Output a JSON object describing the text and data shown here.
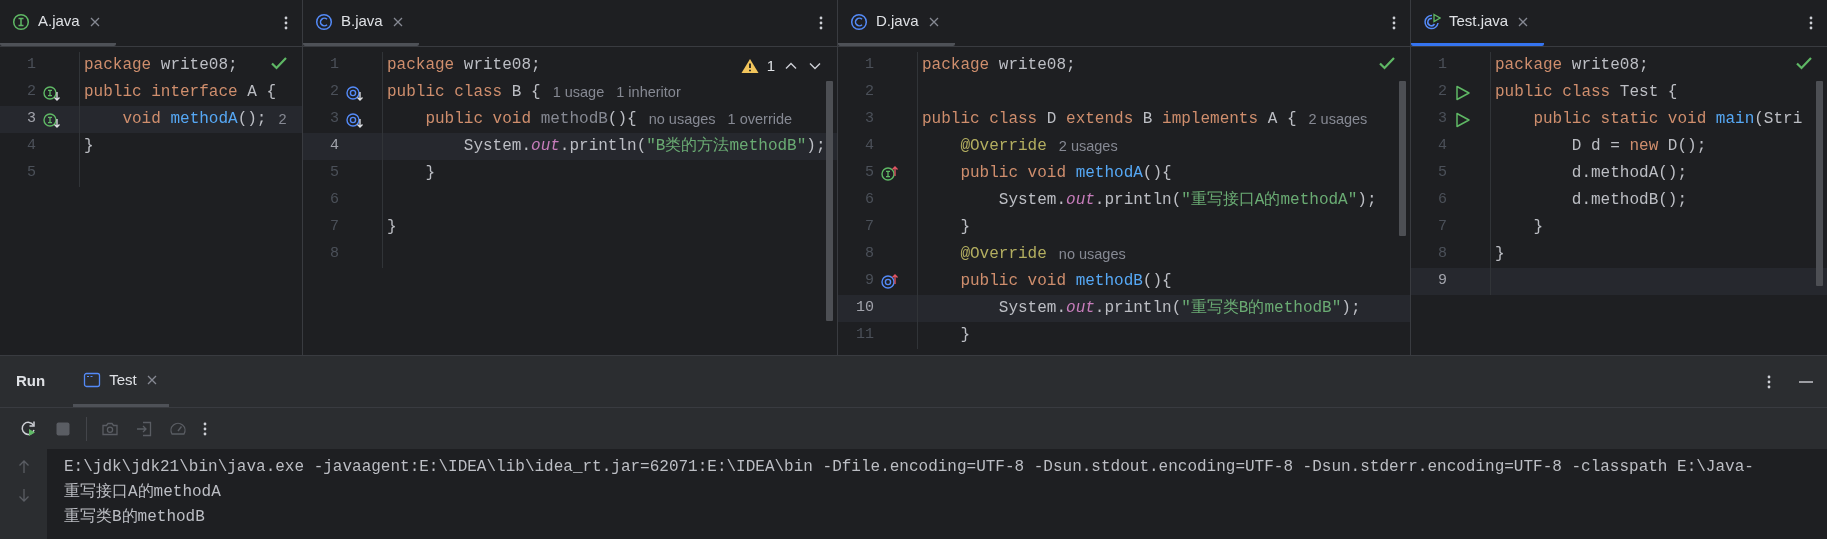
{
  "editors": [
    {
      "tab": {
        "label": "A.java",
        "kind": "interface",
        "selected": false
      },
      "status": {
        "kind": "ok"
      },
      "lines": [
        {
          "number": "1",
          "current": false,
          "tokens": [
            {
              "kind": "kw",
              "text": "package "
            },
            {
              "kind": "plain",
              "text": "write08;"
            }
          ]
        },
        {
          "number": "2",
          "current": false,
          "gutter": {
            "kind": "interface-impl"
          },
          "tokens": [
            {
              "kind": "kw",
              "text": "public interface "
            },
            {
              "kind": "plain",
              "text": "A {"
            }
          ]
        },
        {
          "number": "3",
          "current": true,
          "gutter": {
            "kind": "interface-impl"
          },
          "tokens": [
            {
              "kind": "kw",
              "text": "    void "
            },
            {
              "kind": "fn",
              "text": "methodA"
            },
            {
              "kind": "plain",
              "text": "();"
            }
          ],
          "hints": [
            "2"
          ]
        },
        {
          "number": "4",
          "current": false,
          "tokens": [
            {
              "kind": "plain",
              "text": "}"
            }
          ]
        },
        {
          "number": "5",
          "current": false
        }
      ]
    },
    {
      "tab": {
        "label": "B.java",
        "kind": "class",
        "selected": false
      },
      "status": {
        "kind": "warning",
        "count": "1"
      },
      "lines": [
        {
          "number": "1",
          "current": false,
          "tokens": [
            {
              "kind": "kw",
              "text": "package "
            },
            {
              "kind": "plain",
              "text": "write08;"
            }
          ]
        },
        {
          "number": "2",
          "current": false,
          "gutter": {
            "kind": "class-impl"
          },
          "tokens": [
            {
              "kind": "kw",
              "text": "public class "
            },
            {
              "kind": "plain",
              "text": "B {"
            }
          ],
          "hints": [
            "1 usage",
            "1 inheritor"
          ]
        },
        {
          "number": "3",
          "current": false,
          "gutter": {
            "kind": "class-impl"
          },
          "tokens": [
            {
              "kind": "kw",
              "text": "    public void "
            },
            {
              "kind": "unused",
              "text": "methodB"
            },
            {
              "kind": "plain",
              "text": "(){"
            }
          ],
          "hints": [
            "no usages",
            "1 override"
          ]
        },
        {
          "number": "4",
          "current": true,
          "tokens": [
            {
              "kind": "plain",
              "text": "        System."
            },
            {
              "kind": "field",
              "text": "out"
            },
            {
              "kind": "plain",
              "text": ".println("
            },
            {
              "kind": "str",
              "text": "\"B类的方法methodB\""
            },
            {
              "kind": "plain",
              "text": ");"
            }
          ]
        },
        {
          "number": "5",
          "current": false,
          "tokens": [
            {
              "kind": "plain",
              "text": "    }"
            }
          ]
        },
        {
          "number": "6",
          "current": false
        },
        {
          "number": "7",
          "current": false,
          "tokens": [
            {
              "kind": "plain",
              "text": "}"
            }
          ]
        },
        {
          "number": "8",
          "current": false
        }
      ]
    },
    {
      "tab": {
        "label": "D.java",
        "kind": "class",
        "selected": false
      },
      "status": {
        "kind": "ok"
      },
      "lines": [
        {
          "number": "1",
          "current": false,
          "tokens": [
            {
              "kind": "kw",
              "text": "package "
            },
            {
              "kind": "plain",
              "text": "write08;"
            }
          ]
        },
        {
          "number": "2",
          "current": false
        },
        {
          "number": "3",
          "current": false,
          "tokens": [
            {
              "kind": "kw",
              "text": "public class "
            },
            {
              "kind": "plain",
              "text": "D "
            },
            {
              "kind": "kw",
              "text": "extends "
            },
            {
              "kind": "plain",
              "text": "B "
            },
            {
              "kind": "kw",
              "text": "implements "
            },
            {
              "kind": "plain",
              "text": "A {"
            }
          ],
          "hints": [
            "2 usages"
          ]
        },
        {
          "number": "4",
          "current": false,
          "tokens": [
            {
              "kind": "ann",
              "text": "    @Override"
            }
          ],
          "hints": [
            "2 usages"
          ]
        },
        {
          "number": "5",
          "current": false,
          "gutter": {
            "kind": "implements-up"
          },
          "tokens": [
            {
              "kind": "kw",
              "text": "    public void "
            },
            {
              "kind": "fn",
              "text": "methodA"
            },
            {
              "kind": "plain",
              "text": "(){"
            }
          ]
        },
        {
          "number": "6",
          "current": false,
          "tokens": [
            {
              "kind": "plain",
              "text": "        System."
            },
            {
              "kind": "field",
              "text": "out"
            },
            {
              "kind": "plain",
              "text": ".println("
            },
            {
              "kind": "str",
              "text": "\"重写接口A的methodA\""
            },
            {
              "kind": "plain",
              "text": ");"
            }
          ]
        },
        {
          "number": "7",
          "current": false,
          "tokens": [
            {
              "kind": "plain",
              "text": "    }"
            }
          ]
        },
        {
          "number": "8",
          "current": false,
          "tokens": [
            {
              "kind": "ann",
              "text": "    @Override"
            }
          ],
          "hints": [
            "no usages"
          ]
        },
        {
          "number": "9",
          "current": false,
          "gutter": {
            "kind": "override-up"
          },
          "tokens": [
            {
              "kind": "kw",
              "text": "    public void "
            },
            {
              "kind": "fn",
              "text": "methodB"
            },
            {
              "kind": "plain",
              "text": "(){"
            }
          ]
        },
        {
          "number": "10",
          "current": true,
          "tokens": [
            {
              "kind": "plain",
              "text": "        System."
            },
            {
              "kind": "field",
              "text": "out"
            },
            {
              "kind": "plain",
              "text": ".println("
            },
            {
              "kind": "str",
              "text": "\"重写类B的methodB\""
            },
            {
              "kind": "plain",
              "text": ");"
            }
          ]
        },
        {
          "number": "11",
          "current": false,
          "tokens": [
            {
              "kind": "plain",
              "text": "    }"
            }
          ]
        }
      ]
    },
    {
      "tab": {
        "label": "Test.java",
        "kind": "runnable-class",
        "selected": true
      },
      "status": {
        "kind": "ok"
      },
      "lines": [
        {
          "number": "1",
          "current": false,
          "tokens": [
            {
              "kind": "kw",
              "text": "package "
            },
            {
              "kind": "plain",
              "text": "write08;"
            }
          ]
        },
        {
          "number": "2",
          "current": false,
          "gutter": {
            "kind": "run"
          },
          "tokens": [
            {
              "kind": "kw",
              "text": "public class "
            },
            {
              "kind": "plain",
              "text": "Test {"
            }
          ]
        },
        {
          "number": "3",
          "current": false,
          "gutter": {
            "kind": "run"
          },
          "tokens": [
            {
              "kind": "kw",
              "text": "    public static void "
            },
            {
              "kind": "fn",
              "text": "main"
            },
            {
              "kind": "plain",
              "text": "(Stri"
            }
          ]
        },
        {
          "number": "4",
          "current": false,
          "tokens": [
            {
              "kind": "plain",
              "text": "        D d = "
            },
            {
              "kind": "kw",
              "text": "new "
            },
            {
              "kind": "plain",
              "text": "D();"
            }
          ]
        },
        {
          "number": "5",
          "current": false,
          "tokens": [
            {
              "kind": "plain",
              "text": "        d.methodA();"
            }
          ]
        },
        {
          "number": "6",
          "current": false,
          "tokens": [
            {
              "kind": "plain",
              "text": "        d.methodB();"
            }
          ]
        },
        {
          "number": "7",
          "current": false,
          "tokens": [
            {
              "kind": "plain",
              "text": "    }"
            }
          ]
        },
        {
          "number": "8",
          "current": false,
          "tokens": [
            {
              "kind": "plain",
              "text": "}"
            }
          ]
        },
        {
          "number": "9",
          "current": true
        }
      ]
    }
  ],
  "run_panel": {
    "title": "Run",
    "tabs": [
      {
        "label": "Test",
        "selected": true
      }
    ],
    "toolbar_groups": [
      {
        "buttons": [
          {
            "kind": "rerun",
            "disabled": false
          },
          {
            "kind": "stop",
            "disabled": true
          }
        ]
      },
      {
        "buttons": [
          {
            "kind": "screenshot",
            "disabled": true
          },
          {
            "kind": "exit",
            "disabled": true
          },
          {
            "kind": "profiler",
            "disabled": true
          },
          {
            "kind": "more",
            "disabled": false
          }
        ]
      }
    ],
    "console": [
      "E:\\jdk\\jdk21\\bin\\java.exe -javaagent:E:\\IDEA\\lib\\idea_rt.jar=62071:E:\\IDEA\\bin -Dfile.encoding=UTF-8 -Dsun.stdout.encoding=UTF-8 -Dsun.stderr.encoding=UTF-8 -classpath E:\\Java-",
      "重写接口A的methodA",
      "重写类B的methodB"
    ]
  }
}
